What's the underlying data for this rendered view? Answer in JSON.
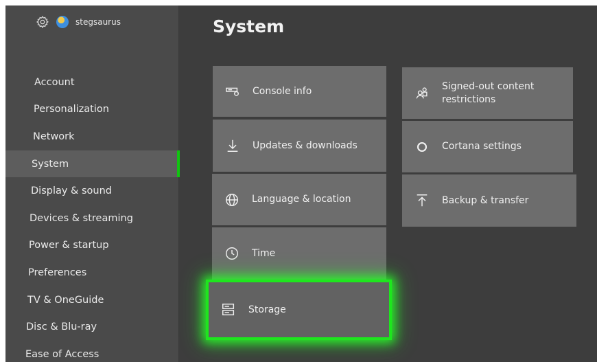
{
  "profile": {
    "gamertag": "stegsaurus"
  },
  "page": {
    "title": "System"
  },
  "sidebar": {
    "items": [
      {
        "label": "Account"
      },
      {
        "label": "Personalization"
      },
      {
        "label": "Network"
      },
      {
        "label": "System",
        "selected": true
      },
      {
        "label": "Display & sound"
      },
      {
        "label": "Devices & streaming"
      },
      {
        "label": "Power & startup"
      },
      {
        "label": "Preferences"
      },
      {
        "label": "TV & OneGuide"
      },
      {
        "label": "Disc & Blu-ray"
      },
      {
        "label": "Ease of Access"
      }
    ]
  },
  "tiles": {
    "console_info": {
      "label": "Console info",
      "icon": "console-icon"
    },
    "updates": {
      "label": "Updates & downloads",
      "icon": "download-icon"
    },
    "language": {
      "label": "Language & location",
      "icon": "globe-icon"
    },
    "time": {
      "label": "Time",
      "icon": "clock-icon"
    },
    "storage": {
      "label": "Storage",
      "icon": "storage-icon",
      "highlighted": true
    },
    "content_restrictions": {
      "label": "Signed-out content restrictions",
      "icon": "people-icon"
    },
    "cortana": {
      "label": "Cortana settings",
      "icon": "cortana-icon"
    },
    "backup": {
      "label": "Backup & transfer",
      "icon": "upload-icon"
    }
  },
  "colors": {
    "highlight": "#1ee61e",
    "selection_bar": "#12c312"
  }
}
